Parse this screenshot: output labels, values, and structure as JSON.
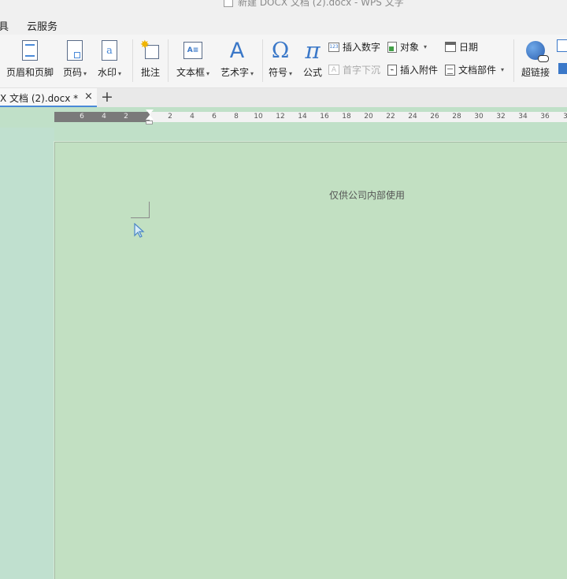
{
  "window": {
    "title": "新建 DOCX 文档 (2).docx - WPS 文字"
  },
  "menu": [
    {
      "label": "具"
    },
    {
      "label": "云服务"
    }
  ],
  "ribbon": {
    "header_footer": "页眉和页脚",
    "page_number": "页码",
    "watermark": "水印",
    "comment": "批注",
    "textbox": "文本框",
    "wordart": "艺术字",
    "symbol": "符号",
    "formula": "公式",
    "insert_number": "插入数字",
    "object": "对象",
    "date": "日期",
    "drop_cap": "首字下沉",
    "insert_attachment": "插入附件",
    "doc_parts": "文档部件",
    "hyperlink": "超链接",
    "wordart_glyph": "A",
    "symbol_glyph": "Ω",
    "formula_glyph": "π",
    "watermark_glyph": "a",
    "textbox_glyph": "A≡",
    "insert_number_glyph": "123"
  },
  "tabs": [
    {
      "label": "X 文档 (2).docx *",
      "active": true
    }
  ],
  "tab_close": "×",
  "tab_add": "+",
  "ruler": {
    "left_labels": [
      "6",
      "4",
      "2"
    ],
    "right_labels": [
      "2",
      "4",
      "6",
      "8",
      "10",
      "12",
      "14",
      "16",
      "18",
      "20",
      "22",
      "24",
      "26",
      "28",
      "30",
      "32",
      "34",
      "36",
      "3"
    ]
  },
  "document": {
    "header_text": "仅供公司内部使用"
  },
  "colors": {
    "page_bg": "#c2e0c2",
    "workspace": "#c0e0c8",
    "accent": "#3b78c8",
    "ruler_dark": "#7a7a7a"
  }
}
